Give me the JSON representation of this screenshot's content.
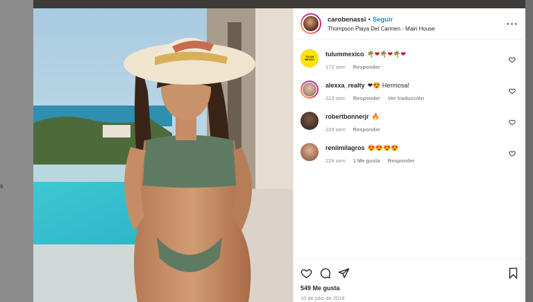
{
  "backdrop": {
    "glyph": "s"
  },
  "post": {
    "username": "carobenassi",
    "separator": "•",
    "follow_label": "Seguir",
    "location": "Thompson Playa Del Carmen - Main House",
    "more_icon": "more-options-icon"
  },
  "comments": [
    {
      "user": "tulummexico",
      "text": "🌴❤🌴❤🌴❤",
      "time": "172 sem",
      "reply": "Responder",
      "avatar_text": "TULUM MEXICO"
    },
    {
      "user": "alexxa_realty",
      "text": "❤😍 Hermosa!",
      "time": "223 sem",
      "reply": "Responder",
      "translate": "Ver traducción"
    },
    {
      "user": "robertbonnerjr",
      "text": "🔥",
      "time": "228 sem",
      "reply": "Responder"
    },
    {
      "user": "reniimilagros",
      "text": "😍😍😍😍",
      "time": "228 sem",
      "likes": "1 Me gusta",
      "reply": "Responder"
    }
  ],
  "footer": {
    "likes": "549 Me gusta",
    "date": "10 de julio de 2019"
  },
  "colors": {
    "link": "#0095f6",
    "text": "#262626",
    "muted": "#8e8e8e"
  }
}
